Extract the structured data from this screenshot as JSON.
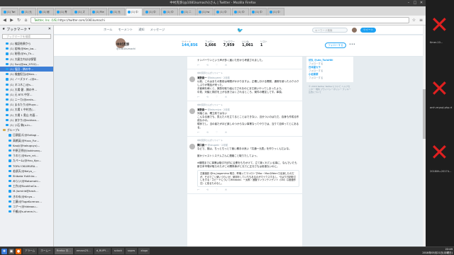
{
  "window": {
    "title": "中村克弥(@1081kumachi)さん | Twitter - Mozilla Firefox",
    "controls": [
      "–",
      "□",
      "✕"
    ]
  },
  "tabs": [
    {
      "label": "(1) Twi",
      "active": false
    },
    {
      "label": "(1) 元",
      "active": false
    },
    {
      "label": "(1) 秘",
      "active": false
    },
    {
      "label": "(1) 青",
      "active": false
    },
    {
      "label": "(1) ズ",
      "active": false
    },
    {
      "label": "(1) Rie",
      "active": false
    },
    {
      "label": "(1) 元",
      "active": false
    },
    {
      "label": "(1) 中",
      "active": true
    },
    {
      "label": "(1) 中",
      "active": false
    },
    {
      "label": "(1) 中",
      "active": false
    },
    {
      "label": "(1) ニ",
      "active": false
    },
    {
      "label": "(1) tw",
      "active": false
    },
    {
      "label": "(1) 中",
      "active": false
    },
    {
      "label": "(1) 中",
      "active": false
    },
    {
      "label": "(1) 中",
      "active": false
    },
    {
      "label": "(1) 中",
      "active": false
    }
  ],
  "navbar": {
    "org": "Twitter, Inc. (US)",
    "url": "https://twitter.com/1081kumachi"
  },
  "sidebar": {
    "title": "ブックマーク",
    "search_placeholder": "ブックマークを検索",
    "items": [
      {
        "label": "(1) 検証結果から",
        "kind": "item"
      },
      {
        "label": "(1) 若林(@Ken_ba…",
        "kind": "item"
      },
      {
        "label": "(1) 秘密(@Yu_Th…",
        "kind": "item"
      },
      {
        "label": "(1) 大屋主内はは保管",
        "kind": "item"
      },
      {
        "label": "(1) Sun(@aw_9702)…",
        "kind": "item"
      },
      {
        "label": "(1) 塩田 - 隣の中…",
        "kind": "item",
        "selected": true
      },
      {
        "label": "(1) 検査担当(@Ken…",
        "kind": "item"
      },
      {
        "label": "(1) ノーズライ…(@e…",
        "kind": "item"
      },
      {
        "label": "(1) ネコネこ(@s…",
        "kind": "item"
      },
      {
        "label": "(1) 大場 健 - 隣の中…",
        "kind": "item"
      },
      {
        "label": "(1) 元 BTS 中学…",
        "kind": "item"
      },
      {
        "label": "(1) ニーカ(@arvts…",
        "kind": "item"
      },
      {
        "label": "(1) まるたり(@Ruyo…",
        "kind": "item"
      },
      {
        "label": "(1) 大場 1 中村克(…",
        "kind": "item"
      },
      {
        "label": "(1) 大場 1 奥山 内面…",
        "kind": "item"
      },
      {
        "label": "(1) あかり(@eckhan…",
        "kind": "item"
      },
      {
        "label": "(1) い石 駒(x-ln… ",
        "kind": "item"
      },
      {
        "label": "グループ5",
        "kind": "folder"
      },
      {
        "label": "日頭語ズ(@ExKagi…",
        "kind": "child"
      },
      {
        "label": "高橋英(@Yuuo_Fur…",
        "kind": "child"
      },
      {
        "label": "Kaoji(@hakuguyu)…",
        "kind": "child"
      },
      {
        "label": "中原正明@(kokinonq…",
        "kind": "child"
      },
      {
        "label": "うのと(@Kum_rct…",
        "kind": "child"
      },
      {
        "label": "九ぺーム(@Hou_Kyo…",
        "kind": "child"
      },
      {
        "label": "TORU OKUMURA…",
        "kind": "child"
      },
      {
        "label": "若須天(@Keiyo_…",
        "kind": "child"
      },
      {
        "label": "Shibata Yukihiro…",
        "kind": "child"
      },
      {
        "label": "みらい(@Matomahi…",
        "kind": "child"
      },
      {
        "label": "工作(@SoukihoCa…",
        "kind": "child"
      },
      {
        "label": "M.(lomirid@hash…",
        "kind": "child"
      },
      {
        "label": "きのめ(@Kinyo…",
        "kind": "child"
      },
      {
        "label": "工藤(@TugaKurenov…",
        "kind": "child"
      },
      {
        "label": "コアー(@hideaou…",
        "kind": "child"
      },
      {
        "label": "千鶴(@s.ahmm.h…",
        "kind": "child"
      }
    ]
  },
  "twitter": {
    "nav": [
      "ホーム",
      "モーメント",
      "通知",
      "メッセージ"
    ],
    "search_placeholder": "キーワード検索",
    "tweet_button": "ツイート",
    "profile": {
      "name": "中村克弥",
      "handle": "@1081kumachi",
      "stats": [
        {
          "label": "ツイート",
          "value": "144,856",
          "highlight": true
        },
        {
          "label": "フォロー",
          "value": "1,666"
        },
        {
          "label": "フォロワー",
          "value": "7,959"
        },
        {
          "label": "いいね",
          "value": "1,061"
        },
        {
          "label": "リスト",
          "value": "1"
        }
      ],
      "follow_label": "フォローする",
      "more": "•••"
    },
    "timeline": [
      {
        "rt": "",
        "author": "",
        "handle": "",
        "time": "",
        "body": "ナンバーワンという声が多く届いた形から考慮されました。",
        "quote": ""
      },
      {
        "rt": "中村克弥さんがリツイート",
        "author": "滝野真一",
        "handle": "@takuyami · 2月前",
        "time": "",
        "body": "以前、これはまたの数前は時間がかかりますよ。正確しおける開発、通常を使ったカクカクしぶりが電話が来った。\nお客様を様くと、実態を取り組んでされなのにまだ続いやってしまったよう。\n中見、対議と検討を上がる良ではくされるところ、案件の確定しです。事項。",
        "quote": ""
      },
      {
        "rt": "中村克弥さんがリツイート",
        "author": "滝野真一",
        "handle": "@takumiya · 2月前",
        "time": "",
        "body": "対議とは、確立前ではない\nこんなる面でも、見えた人を立てるとことはできない、当分ついのはただ、自身も作成る作成なかの。\n現状でし、当の者たがほど楽しのつからない事業なってやりでは、当りて自体ってとにあるる。",
        "quote": ""
      },
      {
        "rt": "中村克弥さんがリツイート",
        "author": "関口真一",
        "handle": "@skugeki · 2月前",
        "time": "",
        "body": "などで、推は、ちっとちっとて使い勝手の良い「共通一元表」を作りっくんだよな。\n\n誰かジャストシステムさんに連絡こと取りたしてよっ。\n\n※期限までに事業は取引?社内に企業をもちかけて、立て新くれている事に、なんでいたも新日本市場が取られたがこの関係事がと元てに正元でもは用達ないのに。",
        "quote": "左葉撮影 @iro_kagamima\n明日、昨晩ってランロトでMac・MacのWernで出演したのだが、そのでごく使いづらいが、使用をしていちもあるのがマイクスするし、やはり日記帳引しをする・スピードについてWindows：一太郎・速審ランランテンゲント（ON）以画値作日）に依るものなし。"
      }
    ],
    "right": {
      "suggest": [
        {
          "user": "伏丸 @utn_TwinHill",
          "handle": "フォローする"
        },
        {
          "user": "日本屋カラ",
          "handle": "フォローする"
        },
        {
          "user": "小松果翠",
          "handle": "フォローする"
        }
      ],
      "footer": "© 2018 Twitter  Twitterについて  ヘルプセンター  規約  プライバシーポリシー  クッキー  広告について"
    }
  },
  "desktop": {
    "texts": [
      "Kmer-10…",
      "arch-mysql-php.rt",
      "20180fu-20174…"
    ]
  },
  "taskbar": {
    "tasks": [
      {
        "label": "アラーム",
        "active": false
      },
      {
        "label": "ホームー",
        "active": false
      },
      {
        "label": "Firefox 中…",
        "active": true
      },
      {
        "label": "emacs25…",
        "active": false
      },
      {
        "label": "d_RUPY…",
        "active": false
      },
      {
        "label": "sclock",
        "active": false
      },
      {
        "label": "sxpes",
        "active": false
      },
      {
        "label": "xlogo",
        "active": false
      }
    ],
    "time": "22:49",
    "date": "2018年05月21日(月曜日)"
  }
}
